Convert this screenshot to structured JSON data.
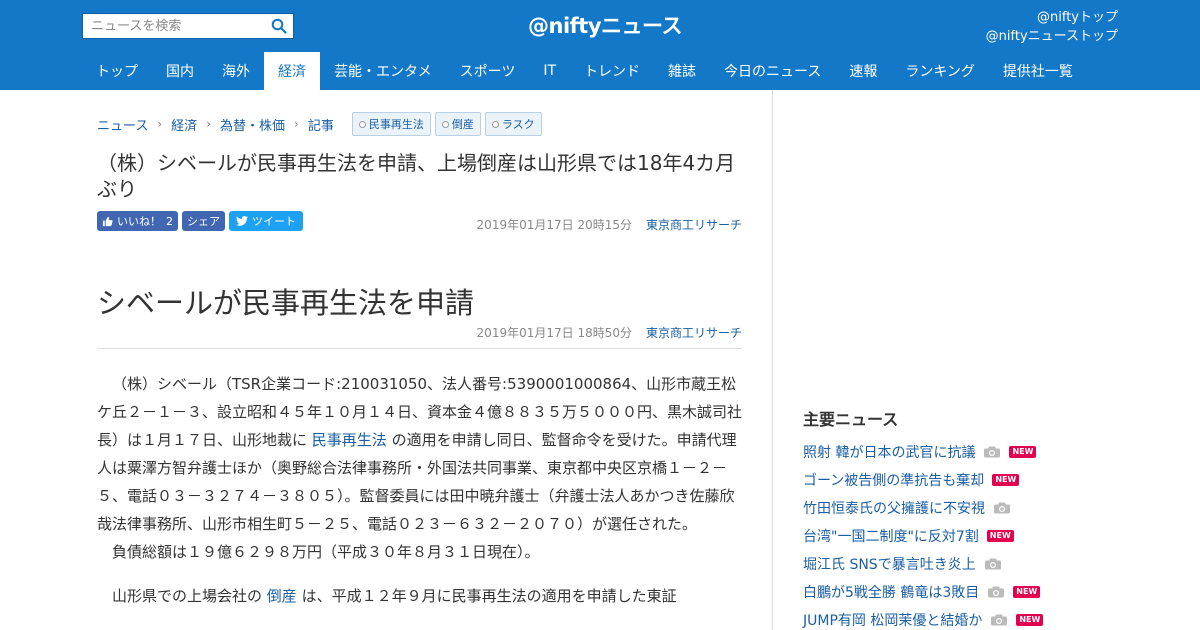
{
  "header": {
    "search_placeholder": "ニュースを検索",
    "logo_text": "@niftyニュース",
    "top_links": [
      "@niftyトップ",
      "@niftyニューストップ"
    ],
    "brand_color": "#1478c8"
  },
  "nav": {
    "items": [
      "トップ",
      "国内",
      "海外",
      "経済",
      "芸能・エンタメ",
      "スポーツ",
      "IT",
      "トレンド",
      "雑誌",
      "今日のニュース",
      "速報",
      "ランキング",
      "提供社一覧"
    ],
    "active": "経済"
  },
  "breadcrumb": {
    "items": [
      "ニュース",
      "経済",
      "為替・株価",
      "記事"
    ],
    "tags": [
      "民事再生法",
      "倒産",
      "ラスク"
    ]
  },
  "article": {
    "title": "（株）シベールが民事再生法を申請、上場倒産は山形県では18年4カ月ぶり",
    "like_label": "いいね！",
    "like_count": "2",
    "share_label": "シェア",
    "tweet_label": "ツイート",
    "date1": "2019年01月17日 20時15分",
    "source": "東京商工リサーチ",
    "subtitle": "シベールが民事再生法を申請",
    "date2": "2019年01月17日 18時50分",
    "p1_a": "（株）シベール（TSR企業コード:210031050、法人番号:5390001000864、山形市蔵王松ケ丘２－１－３、設立昭和４５年１０月１４日、資本金４億８８３５万５０００円、黒木誠司社長）は１月１７日、山形地裁に ",
    "p1_link": "民事再生法",
    "p1_b": " の適用を申請し同日、監督命令を受けた。申請代理人は粟澤方智弁護士ほか（奥野総合法律事務所・外国法共同事業、東京都中央区京橋１－２－５、電話０３－３２７４－３８０５）。監督委員には田中暁弁護士（弁護士法人あかつき佐藤欣哉法律事務所、山形市相生町５－２５、電話０２３－６３２－２０７０）が選任された。",
    "p2": "負債総額は１９億６２９８万円（平成３０年８月３１日現在）。",
    "p3_a": "山形県での上場会社の ",
    "p3_link": "倒産",
    "p3_b": " は、平成１２年９月に民事再生法の適用を申請した東証"
  },
  "sidebar": {
    "title": "主要ニュース",
    "items": [
      {
        "text": "照射 韓が日本の武官に抗議",
        "camera": true,
        "new": true
      },
      {
        "text": "ゴーン被告側の準抗告も棄却",
        "camera": false,
        "new": true
      },
      {
        "text": "竹田恒泰氏の父擁護に不安視",
        "camera": true,
        "new": false
      },
      {
        "text": "台湾\"一国二制度\"に反対7割",
        "camera": false,
        "new": true
      },
      {
        "text": "堀江氏 SNSで暴言吐き炎上",
        "camera": true,
        "new": false
      },
      {
        "text": "白鵬が5戦全勝 鶴竜は3敗目",
        "camera": true,
        "new": true
      },
      {
        "text": "JUMP有岡 松岡茉優と結婚か",
        "camera": true,
        "new": true
      }
    ],
    "new_label": "NEW"
  }
}
